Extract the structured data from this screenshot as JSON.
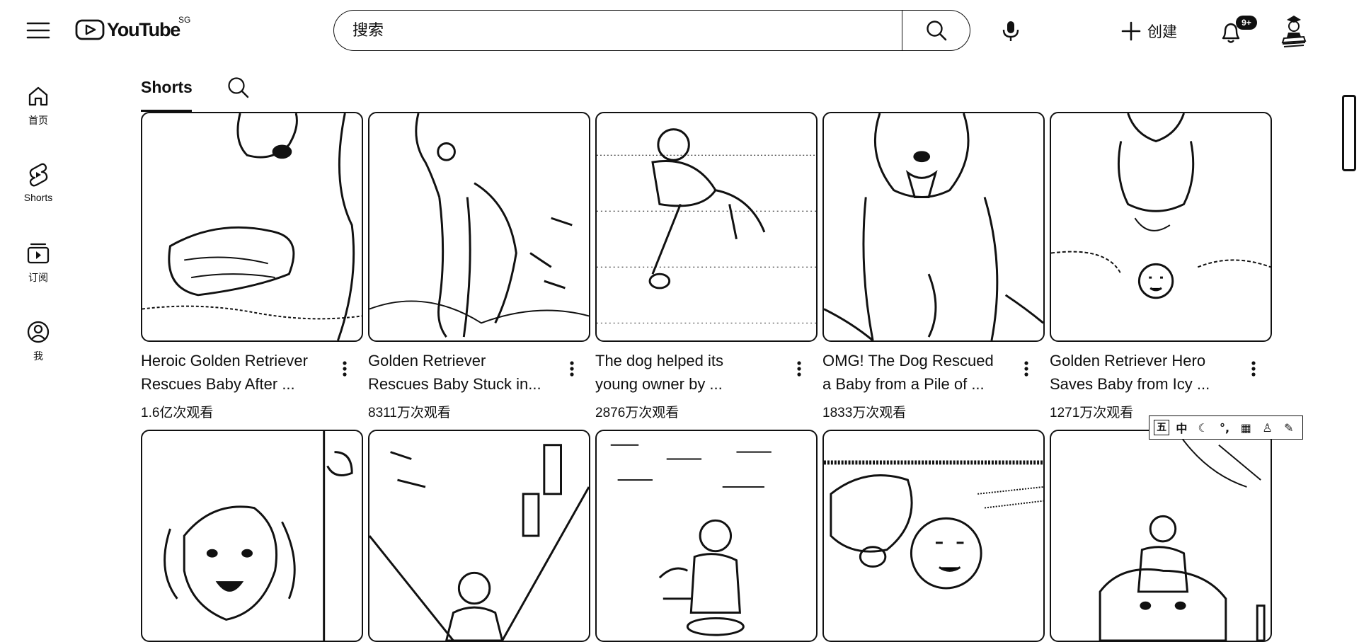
{
  "header": {
    "logo_text": "YouTube",
    "region_code": "SG",
    "search_placeholder": "搜索",
    "create_label": "创建",
    "notification_count": "9+"
  },
  "rail": [
    {
      "label": "首页",
      "icon": "home-icon"
    },
    {
      "label": "Shorts",
      "icon": "shorts-icon"
    },
    {
      "label": "订阅",
      "icon": "subscriptions-icon"
    },
    {
      "label": "我",
      "icon": "you-icon"
    }
  ],
  "tabs": {
    "shorts_label": "Shorts"
  },
  "videos": [
    {
      "title": "Heroic Golden Retriever\nRescues Baby After ...",
      "views": "1.6亿次观看"
    },
    {
      "title": "Golden Retriever\nRescues Baby Stuck in...",
      "views": "8311万次观看"
    },
    {
      "title": "The dog helped its\nyoung owner by ...",
      "views": "2876万次观看"
    },
    {
      "title": "OMG!  The Dog Rescued\na Baby from a Pile of ...",
      "views": "1833万次观看"
    },
    {
      "title": "Golden Retriever Hero\nSaves Baby from Icy ...",
      "views": "1271万次观看"
    },
    {
      "title": "",
      "views": ""
    },
    {
      "title": "",
      "views": ""
    },
    {
      "title": "",
      "views": ""
    },
    {
      "title": "",
      "views": ""
    },
    {
      "title": "",
      "views": ""
    }
  ],
  "ime_toolbar": {
    "items": [
      "五",
      "中",
      "☾",
      "°,",
      "▦",
      "♙",
      "✎"
    ]
  },
  "colors": {
    "text": "#0f0f0f",
    "background": "#ffffff"
  }
}
